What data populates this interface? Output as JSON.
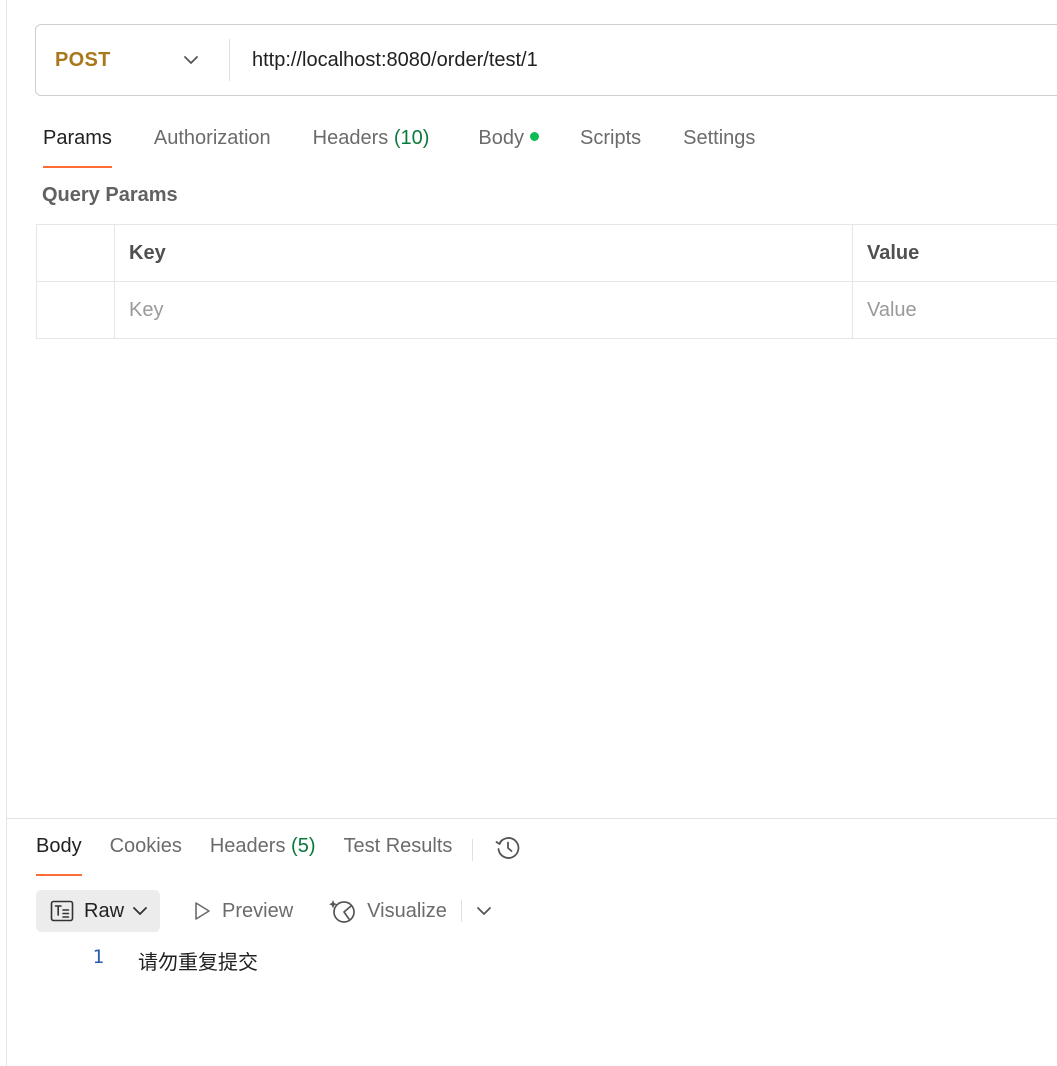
{
  "request": {
    "method": "POST",
    "url": "http://localhost:8080/order/test/1"
  },
  "request_tabs": {
    "params": "Params",
    "authorization": "Authorization",
    "headers": "Headers",
    "headers_count": "(10)",
    "body": "Body",
    "scripts": "Scripts",
    "settings": "Settings"
  },
  "query_params": {
    "title": "Query Params",
    "col_key": "Key",
    "col_value": "Value",
    "key_placeholder": "Key",
    "value_placeholder": "Value"
  },
  "response_tabs": {
    "body": "Body",
    "cookies": "Cookies",
    "headers": "Headers",
    "headers_count": "(5)",
    "test_results": "Test Results"
  },
  "response_toolbar": {
    "raw": "Raw",
    "preview": "Preview",
    "visualize": "Visualize"
  },
  "response_body": {
    "line_number": "1",
    "text": "请勿重复提交"
  },
  "colors": {
    "method": "#a9781a",
    "active_tab_underline": "#ff6c37",
    "count": "#0a7a3b",
    "body_dot": "#0cbb52"
  }
}
